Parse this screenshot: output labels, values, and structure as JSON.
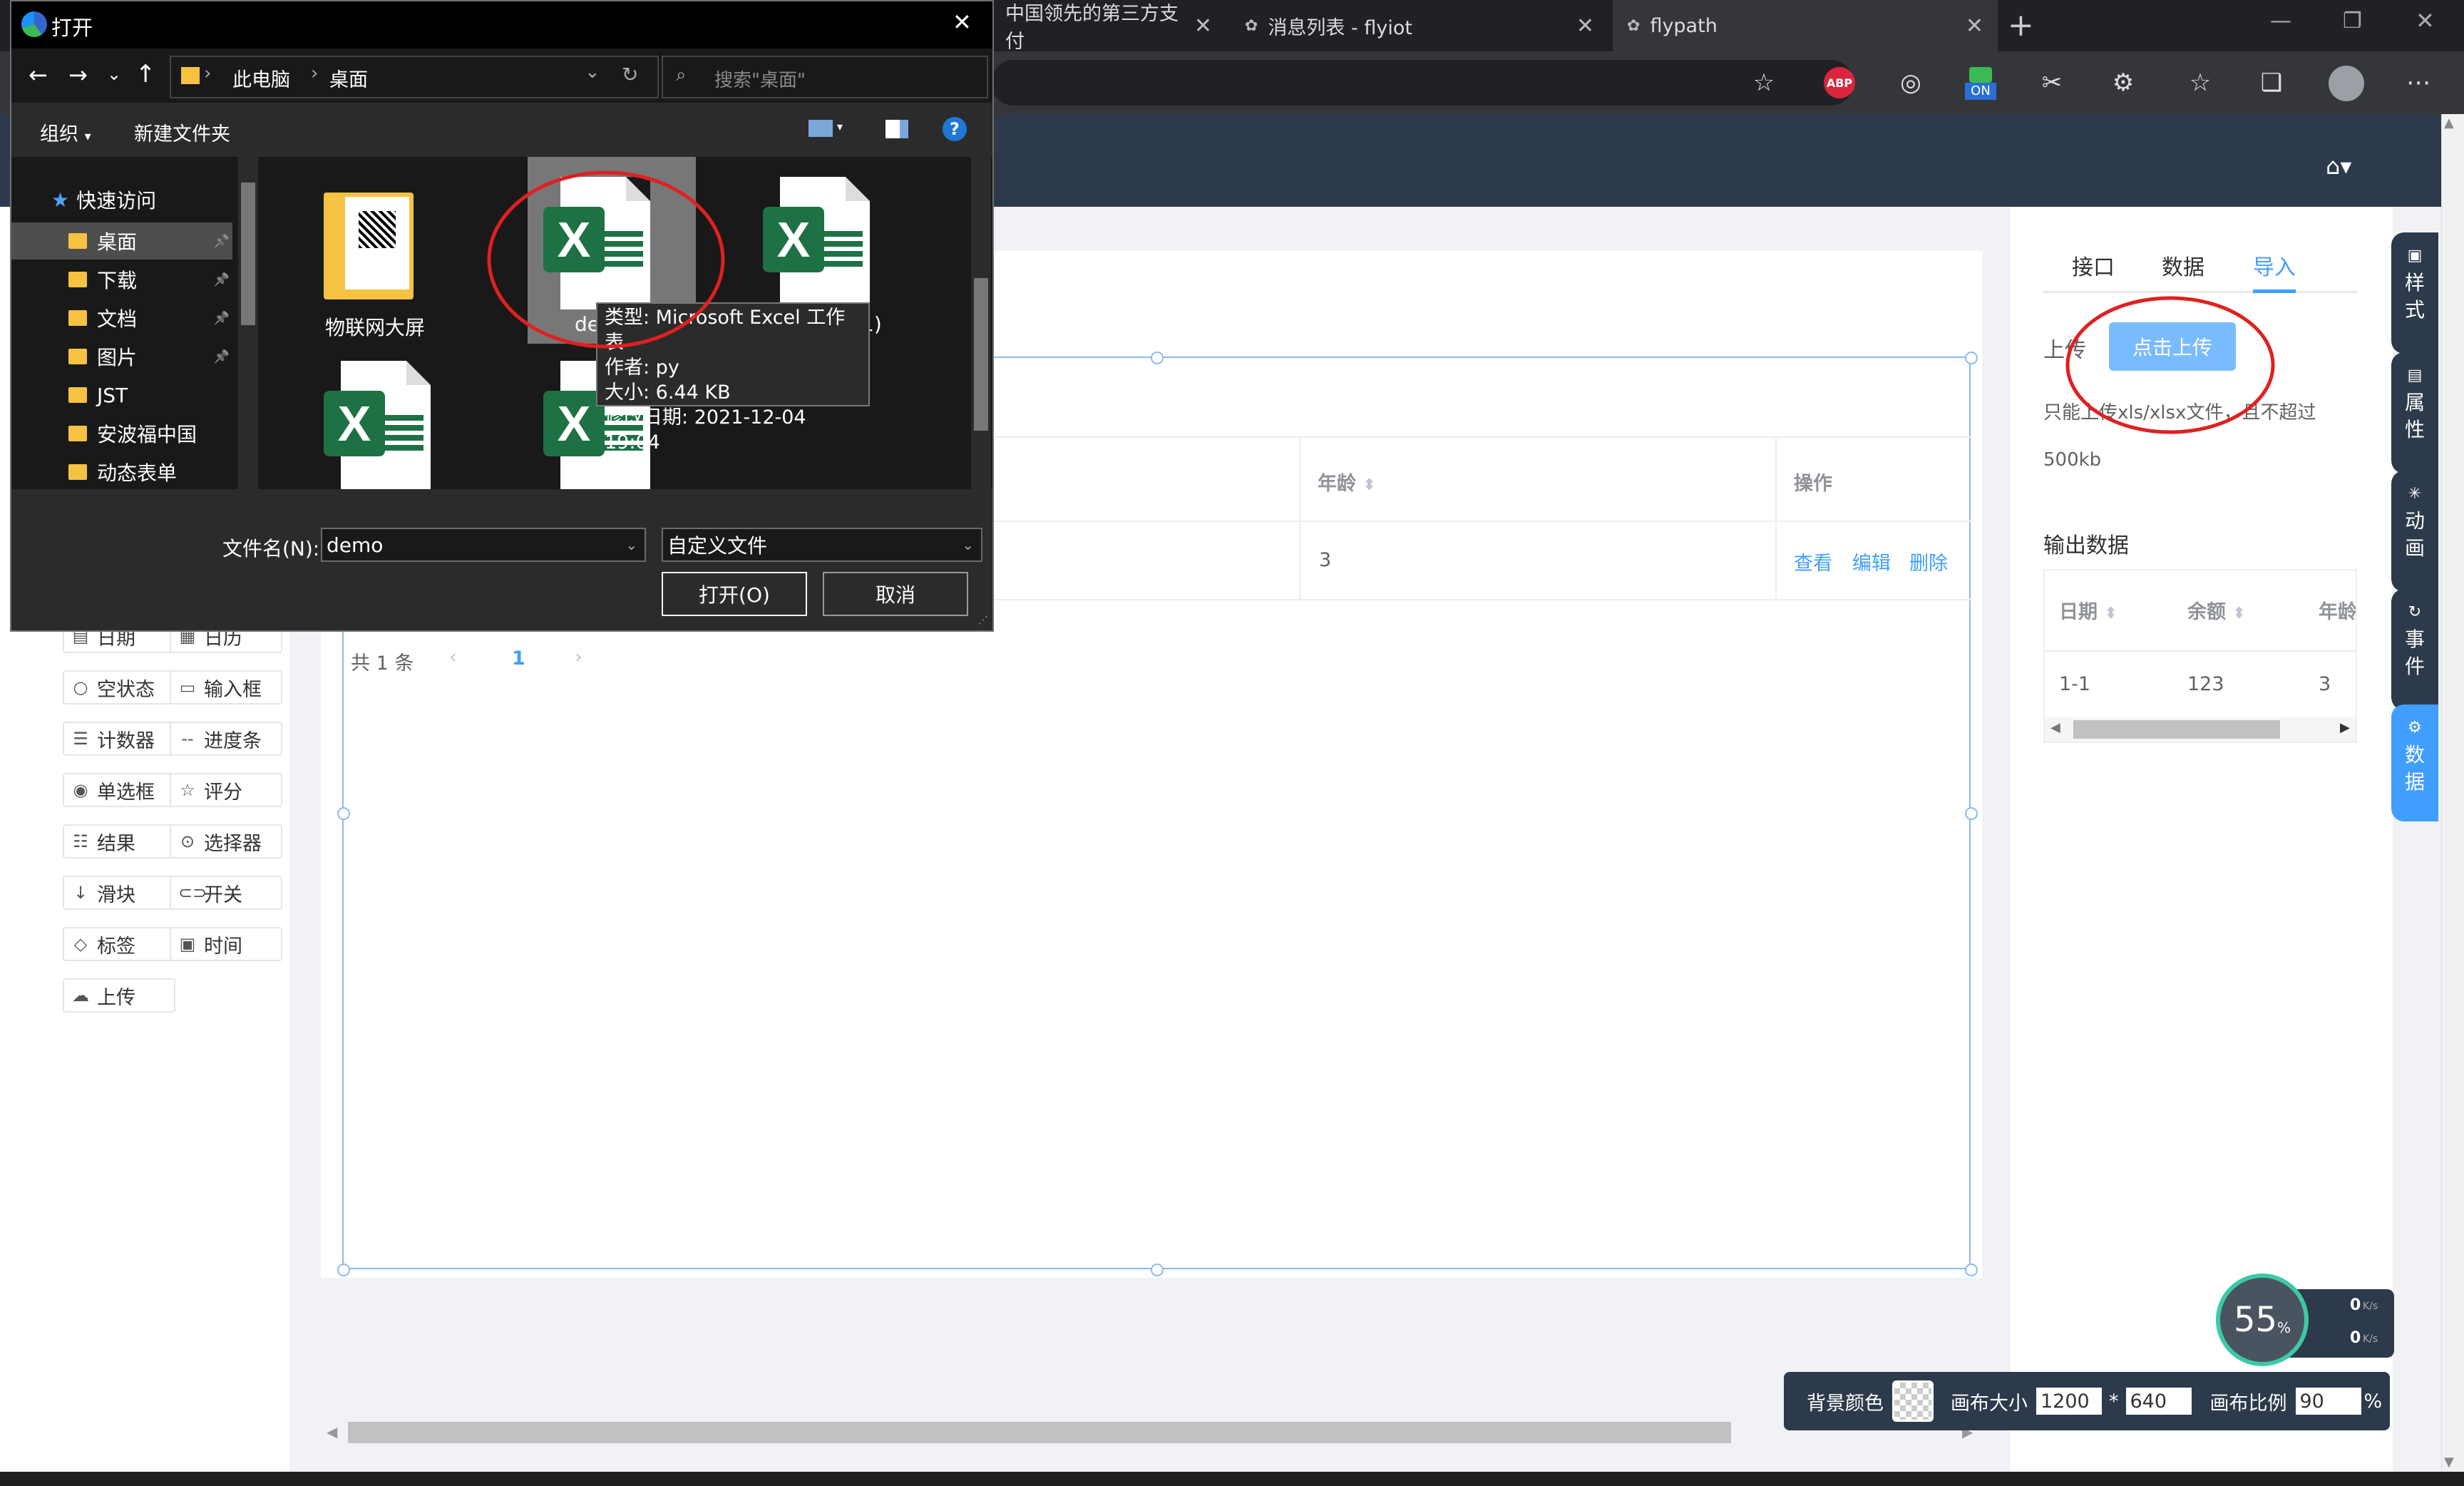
{
  "browser": {
    "tabs": [
      {
        "label": "中国领先的第三方支付"
      },
      {
        "label": "消息列表 - flyiot"
      },
      {
        "label": "flypath"
      }
    ],
    "new_tab": "+",
    "extension_badge": "ON",
    "abp": "ABP"
  },
  "dialog": {
    "title": "打开",
    "breadcrumb": [
      "此电脑",
      "桌面"
    ],
    "search_placeholder": "搜索\"桌面\"",
    "organize": "组织",
    "new_folder": "新建文件夹",
    "help": "?",
    "nav": {
      "quick_access": "快速访问",
      "items": [
        {
          "label": "桌面",
          "pinned": true
        },
        {
          "label": "下载",
          "pinned": true
        },
        {
          "label": "文档",
          "pinned": true
        },
        {
          "label": "图片",
          "pinned": true
        },
        {
          "label": "JST",
          "pinned": false
        },
        {
          "label": "安波福中国",
          "pinned": false
        },
        {
          "label": "动态表单",
          "pinned": false
        }
      ]
    },
    "files": [
      {
        "name": "物联网大屏",
        "type": "folder"
      },
      {
        "name": "de",
        "type": "excel"
      },
      {
        "name": "1)",
        "type": "excel"
      },
      {
        "name": "",
        "type": "excel"
      },
      {
        "name": "",
        "type": "excel"
      }
    ],
    "tooltip": {
      "type": "类型: Microsoft Excel 工作表",
      "author": "作者: py",
      "size": "大小: 6.44 KB",
      "modified": "修改日期: 2021-12-04 19:04"
    },
    "filename_label": "文件名(N):",
    "filename_value": "demo",
    "filter_value": "自定义文件",
    "open_btn": "打开(O)",
    "cancel_btn": "取消"
  },
  "palette": {
    "items": [
      {
        "label": "日期",
        "icon": "calendar-icon",
        "glyph": "▤"
      },
      {
        "label": "日历",
        "icon": "calendar-grid-icon",
        "glyph": "▦"
      },
      {
        "label": "空状态",
        "icon": "empty-icon",
        "glyph": "○"
      },
      {
        "label": "输入框",
        "icon": "input-icon",
        "glyph": "▭"
      },
      {
        "label": "计数器",
        "icon": "counter-icon",
        "glyph": "☰"
      },
      {
        "label": "进度条",
        "icon": "progress-icon",
        "glyph": "--"
      },
      {
        "label": "单选框",
        "icon": "radio-icon",
        "glyph": "◉"
      },
      {
        "label": "评分",
        "icon": "star-icon",
        "glyph": "☆"
      },
      {
        "label": "结果",
        "icon": "result-icon",
        "glyph": "☷"
      },
      {
        "label": "选择器",
        "icon": "select-icon",
        "glyph": "⊙"
      },
      {
        "label": "滑块",
        "icon": "slider-icon",
        "glyph": "↓"
      },
      {
        "label": "开关",
        "icon": "switch-icon",
        "glyph": "⊂⊃"
      },
      {
        "label": "标签",
        "icon": "tag-icon",
        "glyph": "◇"
      },
      {
        "label": "时间",
        "icon": "clock-icon",
        "glyph": "▣"
      },
      {
        "label": "上传",
        "icon": "upload-icon",
        "glyph": "☁"
      }
    ]
  },
  "table": {
    "headers": {
      "age": "年龄",
      "action": "操作"
    },
    "row": {
      "age": "3",
      "view": "查看",
      "edit": "编辑",
      "delete": "删除"
    },
    "pagination": {
      "total": "共 1 条",
      "page": "1"
    }
  },
  "right_panel": {
    "tabs": [
      "接口",
      "数据",
      "导入"
    ],
    "active_tab": "导入",
    "upload_label": "上传",
    "upload_btn": "点击上传",
    "hint": "只能上传xls/xlsx文件，且不超过",
    "hint2": "500kb",
    "output_title": "输出数据",
    "output_headers": [
      "日期",
      "余额",
      "年龄"
    ],
    "output_row": [
      "1-1",
      "123",
      "3"
    ]
  },
  "side_tabs": [
    "样式",
    "属性",
    "动画",
    "事件",
    "数据"
  ],
  "canvas_bar": {
    "bg_label": "背景颜色",
    "size_label": "画布大小",
    "width": "1200",
    "times": "*",
    "height": "640",
    "scale_label": "画布比例",
    "scale": "90",
    "percent": "%"
  },
  "speed_widget": {
    "percent": "55",
    "unit": "%",
    "up": "0",
    "down": "0",
    "rate_unit": "K/s"
  },
  "colors": {
    "accent": "#409eff",
    "header": "#2d3a4b",
    "excel_green": "#1e7145",
    "annotation_red": "#e02020"
  }
}
